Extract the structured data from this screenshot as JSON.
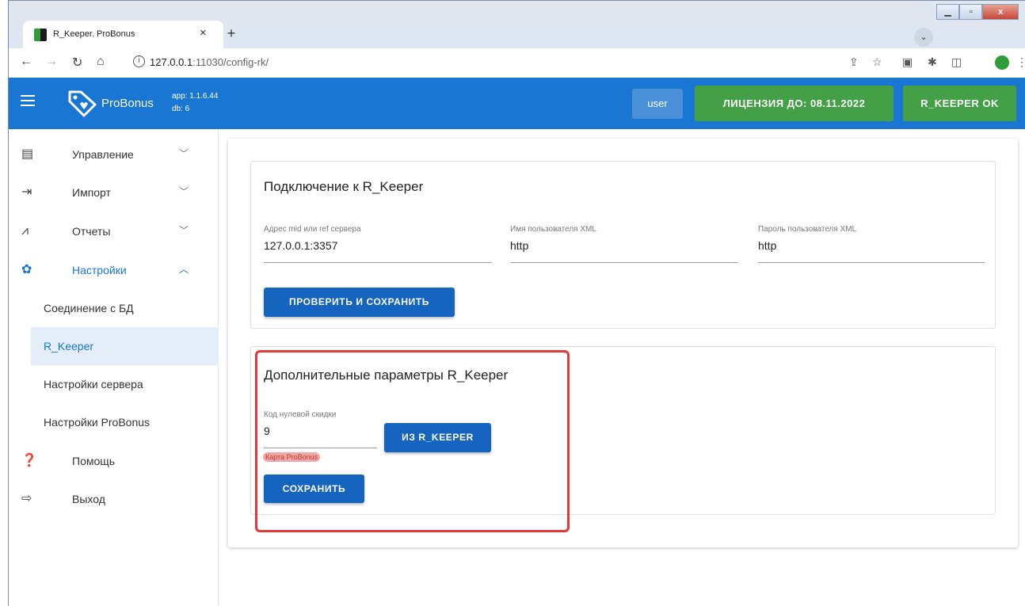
{
  "browser": {
    "tab_title": "R_Keeper. ProBonus",
    "tab_close": "×",
    "new_tab": "+",
    "window_min": "▁",
    "window_max": "▫",
    "window_close": "x",
    "url_host": "127.0.0.1",
    "url_path": ":11030/config-rk/"
  },
  "appbar": {
    "brand": "ProBonus",
    "app_version": "app: 1.1.6.44",
    "db_version": "db: 6",
    "user_label": "user",
    "license_label": "ЛИЦЕНЗИЯ ДО: 08.11.2022",
    "rkeeper_status": "R_KEEPER OK",
    "accent_color": "#1976d2",
    "status_color": "#43a047"
  },
  "sidebar": {
    "items": [
      {
        "label": "Управление",
        "icon": "clipboard-icon",
        "chevron": "﹀"
      },
      {
        "label": "Импорт",
        "icon": "import-icon",
        "chevron": "﹀"
      },
      {
        "label": "Отчеты",
        "icon": "chart-icon",
        "chevron": "﹀"
      },
      {
        "label": "Настройки",
        "icon": "gear-icon",
        "chevron": "︿"
      },
      {
        "label": "Помощь",
        "icon": "help-icon"
      },
      {
        "label": "Выход",
        "icon": "logout-icon"
      }
    ],
    "sub_items": [
      {
        "label": "Соединение с БД"
      },
      {
        "label": "R_Keeper"
      },
      {
        "label": "Настройки сервера"
      },
      {
        "label": "Настройки ProBonus"
      }
    ]
  },
  "connection": {
    "title": "Подключение к R_Keeper",
    "server_label": "Адрес mid или ref сервера",
    "server_value": "127.0.0.1:3357",
    "user_label": "Имя пользователя XML",
    "user_value": "http",
    "password_label": "Пароль пользователя XML",
    "password_value": "http",
    "check_save_button": "ПРОВЕРИТЬ И СОХРАНИТЬ"
  },
  "extra": {
    "title": "Дополнительные параметры R_Keeper",
    "discount_label": "Код нулевой скидки",
    "discount_value": "9",
    "from_rkeeper_button": "ИЗ R_KEEPER",
    "card_chip": "Карта ProBonus",
    "save_button": "СОХРАНИТЬ",
    "highlight_color": "#e53935"
  }
}
